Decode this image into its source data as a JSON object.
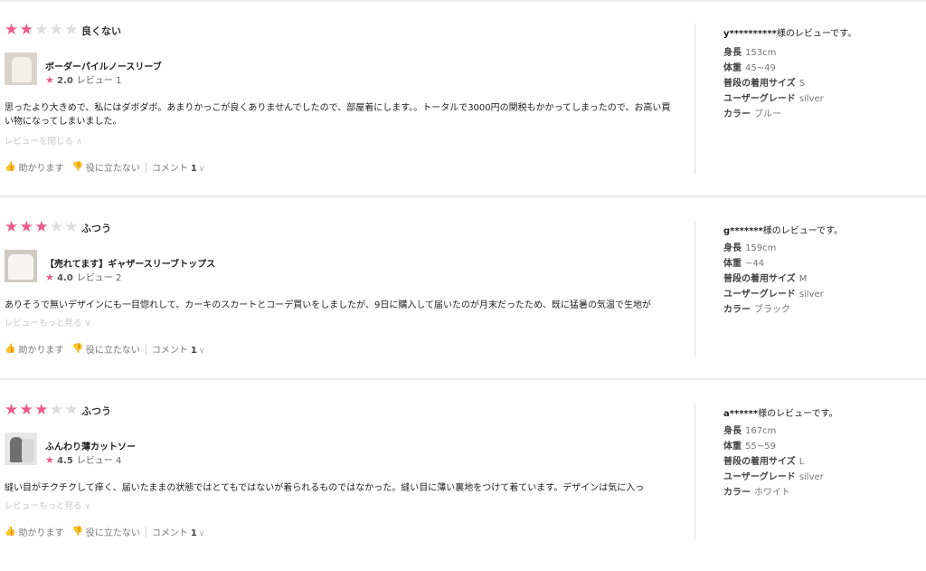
{
  "reviews": [
    {
      "rating": 2,
      "verdict": "良くない",
      "product_name": "ボーダーパイルノースリーブ",
      "product_score": "2.0",
      "product_reviews": "レビュー 1",
      "body": "思ったより大きめで、私にはダボダボ。あまりかっこが良くありませんでしたので、部屋着にします。。トータルで3000円の関税もかかってしまったので、お高い買い物になってしまいました。",
      "toggle_label": "レビューを閉じる",
      "toggle_icon": "∧",
      "helpful_label": "助かります",
      "not_helpful_label": "役に立たない",
      "comment_label": "コメント",
      "comment_count": "1",
      "reviewer_id": "y**********",
      "reviewer_suffix": "様のレビューです。",
      "height_label": "身長",
      "height": "153cm",
      "weight_label": "体重",
      "weight": "45~49",
      "size_label": "普段の着用サイズ",
      "size": "S",
      "grade_label": "ユーザーグレード",
      "grade": "silver",
      "color_label": "カラー",
      "color": "ブルー"
    },
    {
      "rating": 3,
      "verdict": "ふつう",
      "product_name": "【売れてます】ギャザースリーブトップス",
      "product_score": "4.0",
      "product_reviews": "レビュー 2",
      "body": "ありそうで無いデザインにも一目惚れして、カーキのスカートとコーデ買いをしましたが、9日に購入して届いたのが月末だったため、既に猛暑の気温で生地が",
      "toggle_label": "レビューもっと見る",
      "toggle_icon": "∨",
      "helpful_label": "助かります",
      "not_helpful_label": "役に立たない",
      "comment_label": "コメント",
      "comment_count": "1",
      "reviewer_id": "g*******",
      "reviewer_suffix": "様のレビューです。",
      "height_label": "身長",
      "height": "159cm",
      "weight_label": "体重",
      "weight": "~44",
      "size_label": "普段の着用サイズ",
      "size": "M",
      "grade_label": "ユーザーグレード",
      "grade": "silver",
      "color_label": "カラー",
      "color": "ブラック"
    },
    {
      "rating": 3,
      "verdict": "ふつう",
      "product_name": "ふんわり薄カットソー",
      "product_score": "4.5",
      "product_reviews": "レビュー 4",
      "body": "縫い目がチクチクして痒く、届いたままの状態ではとてもではないが着られるものではなかった。縫い目に薄い裏地をつけて着ています。デザインは気に入っ",
      "toggle_label": "レビューもっと見る",
      "toggle_icon": "∨",
      "helpful_label": "助かります",
      "not_helpful_label": "役に立たない",
      "comment_label": "コメント",
      "comment_count": "1",
      "reviewer_id": "a******",
      "reviewer_suffix": "様のレビューです。",
      "height_label": "身長",
      "height": "167cm",
      "weight_label": "体重",
      "weight": "55~59",
      "size_label": "普段の着用サイズ",
      "size": "L",
      "grade_label": "ユーザーグレード",
      "grade": "silver",
      "color_label": "カラー",
      "color": "ホワイト"
    }
  ],
  "icons": {
    "star": "star-icon",
    "thumbs_up": "thumbs-up-icon",
    "thumbs_down": "thumbs-down-icon",
    "chevron": "chevron-down-icon"
  },
  "colors": {
    "accent_pink": "#ef5a8c",
    "divider": "#ececec"
  }
}
